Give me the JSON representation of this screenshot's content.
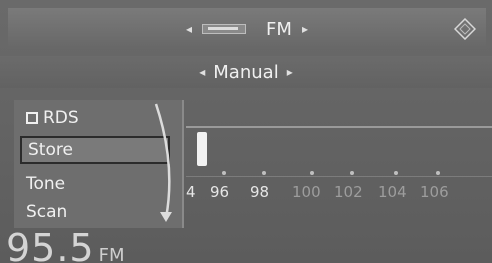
{
  "source": {
    "label": "FM",
    "left_arrow": "◂",
    "right_arrow": "▸"
  },
  "mode": {
    "label": "Manual",
    "left_arrow": "◂",
    "right_arrow": "▸"
  },
  "menu": {
    "items": [
      {
        "label": "RDS",
        "checkbox": true
      },
      {
        "label": "Store",
        "selected": true
      },
      {
        "label": "Tone"
      },
      {
        "label": "Scan"
      }
    ]
  },
  "scale": {
    "labels": [
      "4",
      "96",
      "98",
      "100",
      "102",
      "104",
      "106"
    ]
  },
  "readout": {
    "frequency": "95.5",
    "band": "FM"
  }
}
